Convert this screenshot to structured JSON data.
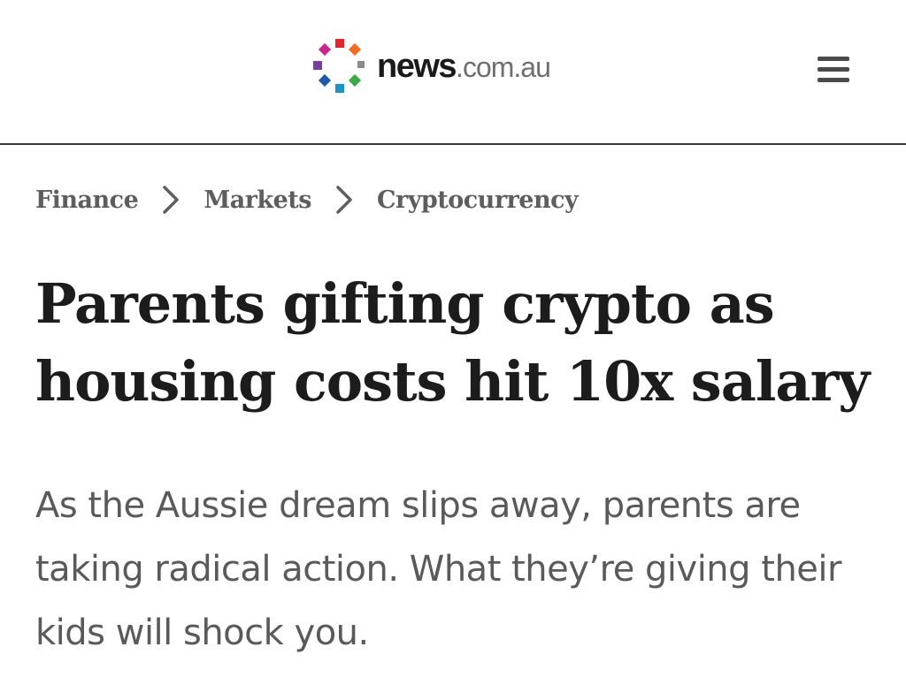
{
  "header": {
    "logo": {
      "brand": "news",
      "domain": ".com.au",
      "icon": "pinwheel-logo-icon",
      "dot_colors": [
        "#e3262d",
        "#f26c22",
        "#8c8c8c",
        "#3bab4a",
        "#1a93c9",
        "#1e5aa8",
        "#7a3f98",
        "#c8268f"
      ]
    },
    "menu_icon": "hamburger-menu-icon"
  },
  "breadcrumb": {
    "items": [
      "Finance",
      "Markets",
      "Cryptocurrency"
    ],
    "separator_icon": "chevron-right-icon"
  },
  "article": {
    "headline": "Parents gifting crypto as housing costs hit 10x salary",
    "standfirst": "As the Aussie dream slips away, parents are taking radical action. What they’re giving their kids will shock you."
  },
  "colors": {
    "text_dark": "#1c1c1c",
    "text_muted": "#5a5a5a",
    "divider": "#3a3a3a"
  }
}
